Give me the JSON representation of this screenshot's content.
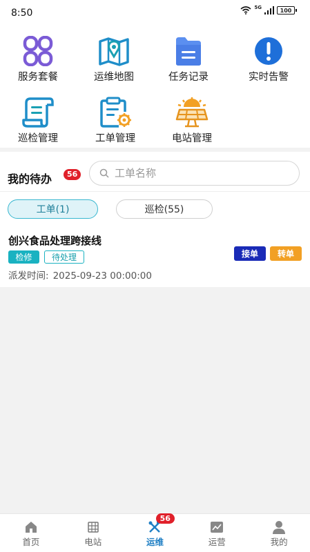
{
  "status_bar": {
    "time": "8:50",
    "battery": "100",
    "network": "5G"
  },
  "grid": [
    {
      "label": "服务套餐",
      "icon": "package-icon"
    },
    {
      "label": "运维地图",
      "icon": "map-icon"
    },
    {
      "label": "任务记录",
      "icon": "folder-icon"
    },
    {
      "label": "实时告警",
      "icon": "alert-icon"
    },
    {
      "label": "巡检管理",
      "icon": "scroll-icon"
    },
    {
      "label": "工单管理",
      "icon": "workorder-icon"
    },
    {
      "label": "电站管理",
      "icon": "solar-station-icon"
    }
  ],
  "todo": {
    "title": "我的待办",
    "badge": "56",
    "search_placeholder": "工单名称",
    "tabs": [
      {
        "label": "工单(1)",
        "active": true
      },
      {
        "label": "巡检(55)",
        "active": false
      }
    ],
    "card": {
      "title": "创兴食品处理跨接线",
      "tags": [
        "检修",
        "待处理"
      ],
      "actions": [
        "接单",
        "转单"
      ],
      "dispatch_label": "派发时间:",
      "dispatch_time": "2025-09-23 00:00:00"
    }
  },
  "nav": {
    "items": [
      {
        "label": "首页",
        "icon": "home-icon"
      },
      {
        "label": "电站",
        "icon": "station-icon"
      },
      {
        "label": "运维",
        "icon": "tools-icon",
        "active": true
      },
      {
        "label": "运营",
        "icon": "chart-icon"
      },
      {
        "label": "我的",
        "icon": "user-icon"
      }
    ],
    "badge": "56"
  },
  "colors": {
    "accent": "#36b6cf",
    "primary": "#1f7fc4",
    "badge": "#e0202a",
    "accept": "#1a2bb7",
    "transfer": "#f2a024"
  }
}
